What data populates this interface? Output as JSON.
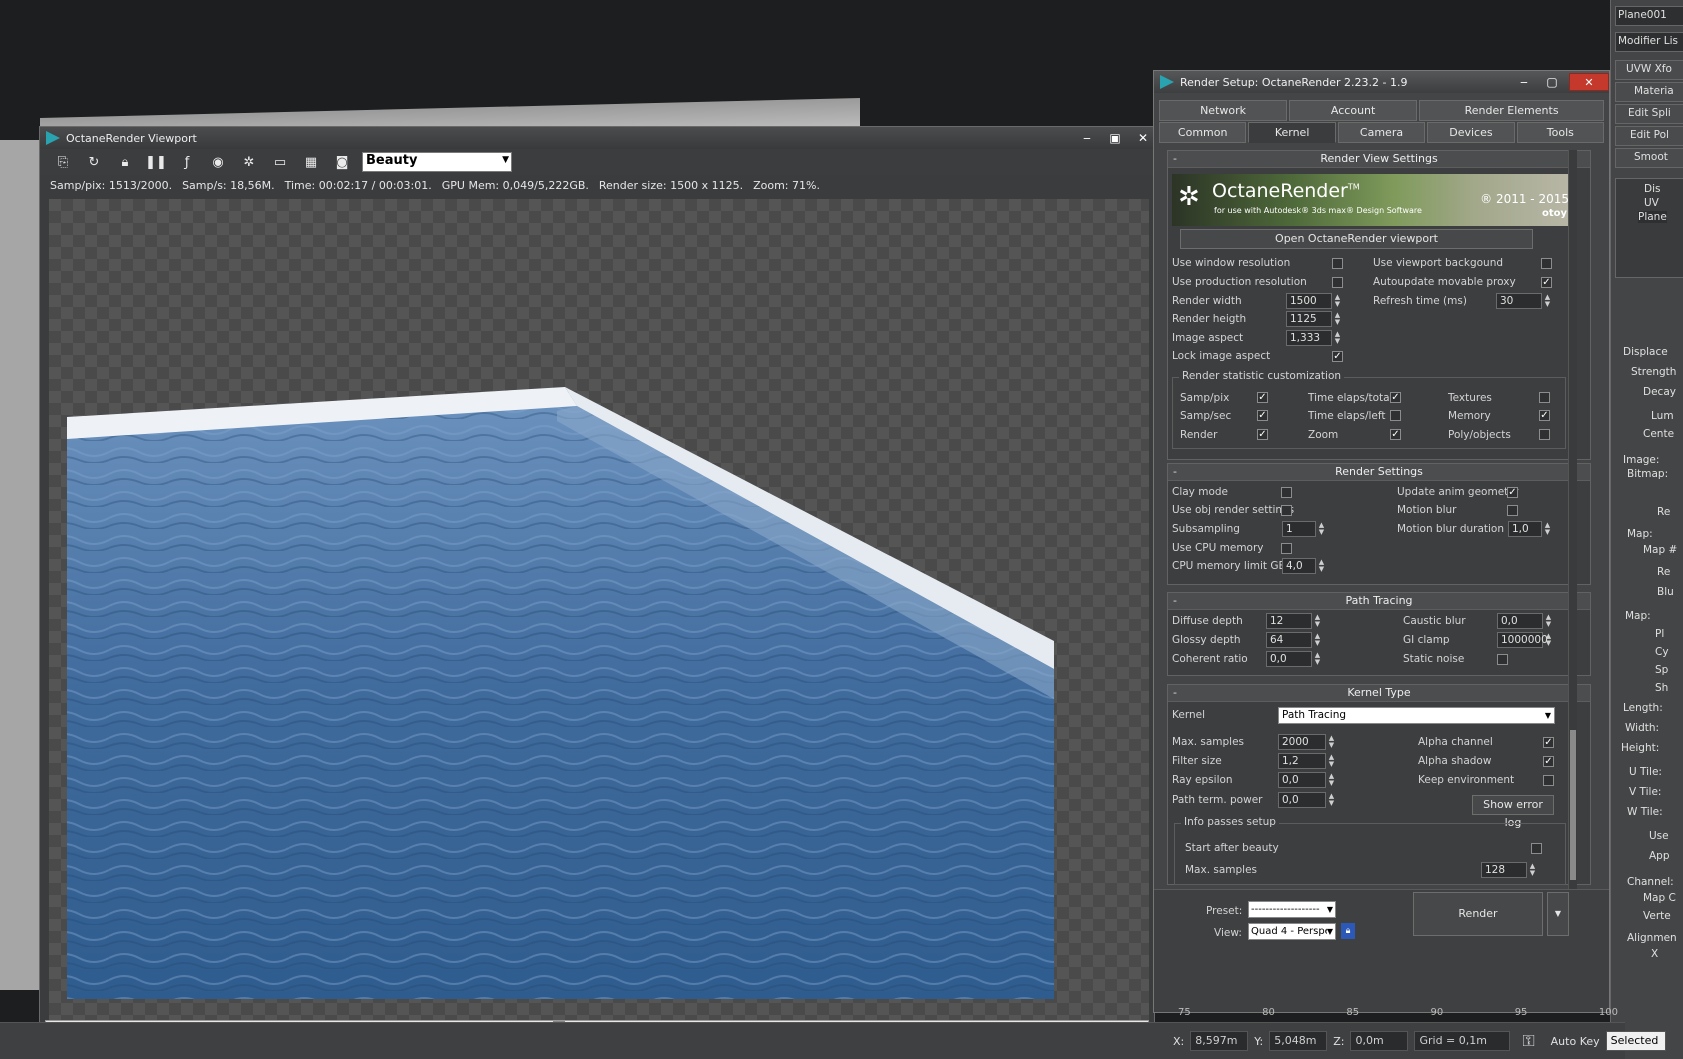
{
  "viewport_window": {
    "title": "OctaneRender Viewport",
    "pass_selected": "Beauty",
    "stats": {
      "samp_pix": "Samp/pix: 1513/2000.",
      "samp_s": "Samp/s: 18,56M.",
      "time": "Time: 00:02:17 / 00:03:01.",
      "gpu_mem": "GPU Mem: 0,049/5,222GB.",
      "render_size": "Render size: 1500 x 1125.",
      "zoom": "Zoom: 71%."
    }
  },
  "render_setup": {
    "title": "Render Setup: OctaneRender 2.23.2 - 1.9",
    "tabs_row1": [
      "Network",
      "Account",
      "Render Elements"
    ],
    "tabs_row2": [
      "Common",
      "Kernel",
      "Camera",
      "Devices",
      "Tools"
    ],
    "active_tab": "Kernel",
    "render_view_settings": {
      "header": "Render View Settings",
      "banner_title": "OctaneRender",
      "banner_tm": "TM",
      "banner_sub": "for use with Autodesk® 3ds max® Design Software",
      "banner_years": "® 2011 - 2015",
      "banner_brand": "otoy",
      "open_viewport_button": "Open OctaneRender viewport",
      "use_window_resolution": "Use window resolution",
      "use_production_resolution": "Use production resolution",
      "use_viewport_background": "Use viewport backgound",
      "autoupdate_movable_proxy": "Autoupdate movable proxy",
      "render_width_label": "Render width",
      "render_width": "1500",
      "render_height_label": "Render heigth",
      "render_height": "1125",
      "image_aspect_label": "Image aspect",
      "image_aspect": "1,333",
      "lock_image_aspect": "Lock image aspect",
      "refresh_time_label": "Refresh time (ms)",
      "refresh_time": "30",
      "stat_group": "Render statistic customization",
      "samp_pix": "Samp/pix",
      "samp_sec": "Samp/sec",
      "render": "Render",
      "time_elaps_total": "Time elaps/total",
      "time_elaps_left": "Time elaps/left",
      "zoom": "Zoom",
      "textures": "Textures",
      "memory": "Memory",
      "poly_objects": "Poly/objects"
    },
    "render_settings": {
      "header": "Render Settings",
      "clay_mode": "Clay mode",
      "use_obj_render_settings": "Use obj render settings",
      "subsampling_label": "Subsampling",
      "subsampling": "1",
      "use_cpu_memory": "Use CPU memory",
      "cpu_memory_limit_label": "CPU memory limit GB",
      "cpu_memory_limit": "4,0",
      "update_anim_geometry": "Update anim geometry",
      "motion_blur": "Motion blur",
      "motion_blur_duration_label": "Motion blur duration",
      "motion_blur_duration": "1,0"
    },
    "path_tracing": {
      "header": "Path Tracing",
      "diffuse_depth_label": "Diffuse depth",
      "diffuse_depth": "12",
      "glossy_depth_label": "Glossy depth",
      "glossy_depth": "64",
      "coherent_ratio_label": "Coherent ratio",
      "coherent_ratio": "0,0",
      "caustic_blur_label": "Caustic blur",
      "caustic_blur": "0,0",
      "gi_clamp_label": "GI clamp",
      "gi_clamp": "1000000,",
      "static_noise": "Static noise"
    },
    "kernel_type": {
      "header": "Kernel Type",
      "kernel_label": "Kernel",
      "kernel_value": "Path Tracing",
      "max_samples_label": "Max. samples",
      "max_samples": "2000",
      "filter_size_label": "Filter size",
      "filter_size": "1,2",
      "ray_epsilon_label": "Ray epsilon",
      "ray_epsilon": "0,0",
      "path_term_power_label": "Path term. power",
      "path_term_power": "0,0",
      "alpha_channel": "Alpha channel",
      "alpha_shadow": "Alpha shadow",
      "keep_environment": "Keep environment",
      "show_error_log": "Show error log",
      "info_passes_group": "Info passes setup",
      "start_after_beauty": "Start after beauty",
      "info_max_samples_label": "Max. samples",
      "info_max_samples": "128"
    },
    "footer": {
      "preset_label": "Preset:",
      "preset_value": "-------------------",
      "view_label": "View:",
      "view_value": "Quad 4 - Perspe",
      "render_button": "Render"
    }
  },
  "command_panel": {
    "object_name": "Plane001",
    "modifier_list": "Modifier Lis",
    "buttons": [
      "UVW Xfo",
      "Materia",
      "Edit Spli",
      "Edit Pol",
      "Smoot"
    ],
    "stack": [
      "Dis",
      "UV",
      "Plane"
    ],
    "params": [
      "Displace",
      "Strength",
      "Decay",
      "Lum",
      "Cente",
      "Image:",
      "Bitmap:",
      "Re",
      "Map:",
      "Map #",
      "Re",
      "Blu",
      "Map:",
      "Pl",
      "Cy",
      "Sp",
      "Sh",
      "Length:",
      "Width:",
      "Height:",
      "U Tile:",
      "V Tile:",
      "W Tile:",
      "Use",
      "App",
      "Channel:",
      "Map C",
      "Verte",
      "Alignmen",
      "X"
    ]
  },
  "statusbar": {
    "x_label": "X:",
    "x_value": "8,597m",
    "y_label": "Y:",
    "y_value": "5,048m",
    "z_label": "Z:",
    "z_value": "0,0m",
    "grid": "Grid = 0,1m",
    "auto_key": "Auto Key",
    "selected": "Selected",
    "ruler": [
      "75",
      "80",
      "85",
      "90",
      "95",
      "100"
    ]
  },
  "colors": {
    "water_deep": "#2f5c8e",
    "water_light": "#5b86b6",
    "pool_rim": "#e9eef3",
    "close_button": "#c4392b"
  }
}
